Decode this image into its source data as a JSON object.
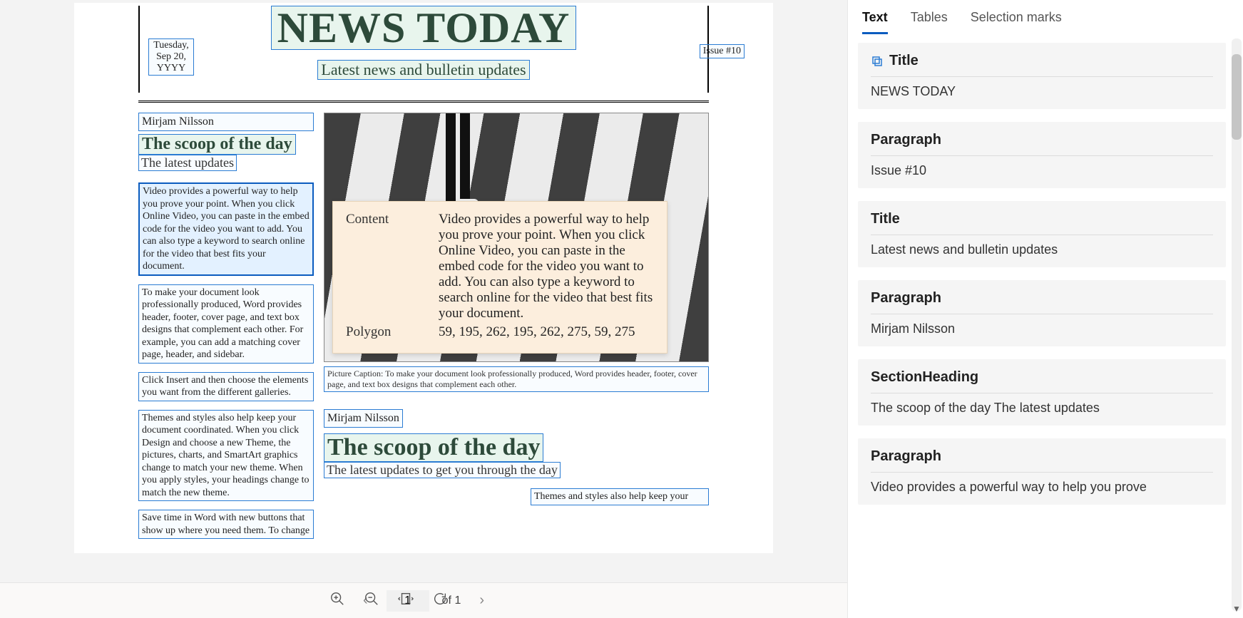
{
  "pager": {
    "page_value": "1",
    "of_label": "of 1"
  },
  "tooltip": {
    "content_label": "Content",
    "content_value": "Video provides a powerful way to help you prove your point. When you click Online Video, you can paste in the embed code for the video you want to add. You can also type a keyword to search online for the video that best fits your document.",
    "polygon_label": "Polygon",
    "polygon_value": "59, 195, 262, 195, 262, 275, 59, 275"
  },
  "doc": {
    "date": "Tuesday, Sep 20, YYYY",
    "title": "NEWS TODAY",
    "subtitle": "Latest news and bulletin updates",
    "issue": "Issue #10",
    "author1": "Mirjam Nilsson",
    "headline1": "The scoop of the day",
    "deck1": "The latest updates",
    "p1": "Video provides a powerful way to help you prove your point. When you click Online Video, you can paste in the embed code for the video you want to add. You can also type a keyword to search online for the video that best fits your document.",
    "p2": "To make your document look professionally produced, Word provides header, footer, cover page, and text box designs that complement each other. For example, you can add a matching cover page, header, and sidebar.",
    "p3": "Click Insert and then choose the elements you want from the different galleries.",
    "p4": "Themes and styles also help keep your document coordinated. When you click Design and choose a new Theme, the pictures, charts, and SmartArt graphics change to match your new theme. When you apply styles, your headings change to match the new theme.",
    "p5": "Save time in Word with new buttons that show up where you need them. To change",
    "caption": "Picture Caption: To make your document look professionally produced, Word provides header, footer, cover page, and text box designs that complement each other.",
    "author2": "Mirjam Nilsson",
    "headline2": "The scoop of the day",
    "deck2": "The latest updates to get you through the day",
    "p6": "Themes and styles also help keep your"
  },
  "tabs": {
    "text": "Text",
    "tables": "Tables",
    "marks": "Selection marks"
  },
  "results": [
    {
      "type": "Title",
      "value": "NEWS TODAY",
      "icon": true
    },
    {
      "type": "Paragraph",
      "value": "Issue #10"
    },
    {
      "type": "Title",
      "value": "Latest news and bulletin updates"
    },
    {
      "type": "Paragraph",
      "value": "Mirjam Nilsson"
    },
    {
      "type": "SectionHeading",
      "value": "The scoop of the day The latest updates"
    },
    {
      "type": "Paragraph",
      "value": "Video provides a powerful way to help you prove"
    }
  ]
}
